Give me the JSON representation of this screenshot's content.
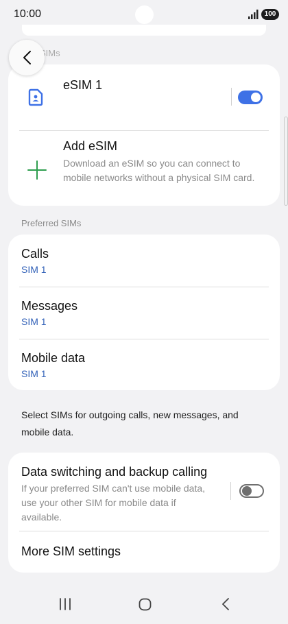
{
  "status_bar": {
    "time": "10:00",
    "battery": "100"
  },
  "header": {
    "faded_section_title": "SIMs"
  },
  "sims": {
    "esim1": {
      "name": "eSIM 1",
      "enabled": true
    },
    "add_esim": {
      "title": "Add eSIM",
      "description": "Download an eSIM so you can connect to mobile networks without a physical SIM card."
    }
  },
  "preferred": {
    "label": "Preferred SIMs",
    "items": [
      {
        "title": "Calls",
        "value": "SIM 1"
      },
      {
        "title": "Messages",
        "value": "SIM 1"
      },
      {
        "title": "Mobile data",
        "value": "SIM 1"
      }
    ]
  },
  "info_text": "Select SIMs for outgoing calls, new messages, and mobile data.",
  "data_switching": {
    "title": "Data switching and backup calling",
    "description": "If your preferred SIM can't use mobile data, use your other SIM for mobile data if available.",
    "enabled": false
  },
  "more_settings": {
    "title": "More SIM settings"
  },
  "colors": {
    "accent": "#3e71e6",
    "link": "#2f5fb7",
    "add_icon": "#2e9e4e",
    "background": "#f2f2f4"
  },
  "icons": {
    "back": "chevron-left-icon",
    "esim": "sim-card-icon",
    "add": "plus-icon",
    "signal": "signal-icon",
    "nav_recents": "recents-icon",
    "nav_home": "home-icon",
    "nav_back": "back-icon"
  }
}
